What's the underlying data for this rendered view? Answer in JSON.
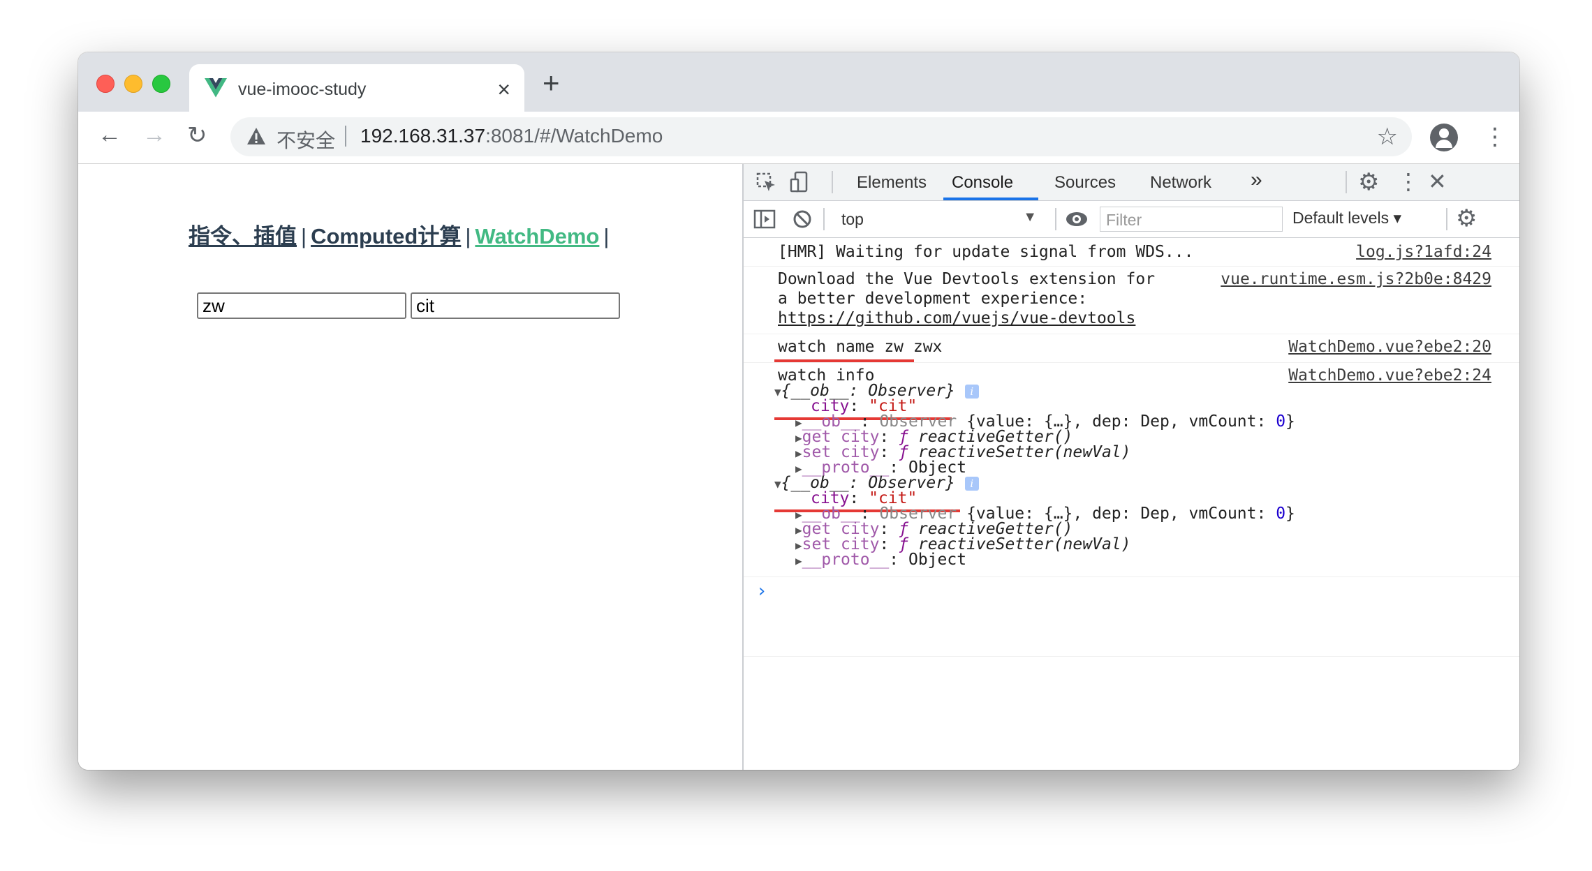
{
  "browser": {
    "tab_title": "vue-imooc-study",
    "tab_close": "×",
    "new_tab": "+",
    "security_label": "不安全",
    "url_host": "192.168.31.37",
    "url_rest": ":8081/#/WatchDemo"
  },
  "page": {
    "nav": [
      {
        "label": "指令、插值",
        "active": false
      },
      {
        "label": "Computed计算",
        "active": false
      },
      {
        "label": "WatchDemo",
        "active": true
      }
    ],
    "pipe": "|",
    "name_input_value": "zw",
    "city_input_value": "cit"
  },
  "devtools": {
    "tabs": [
      "Elements",
      "Console",
      "Sources",
      "Network"
    ],
    "active_tab": "Console",
    "more_tabs": "»",
    "context": "top",
    "filter_placeholder": "Filter",
    "levels": "Default levels ▾",
    "messages": {
      "hmr": {
        "text": "[HMR] Waiting for update signal from WDS...",
        "source": "log.js?1afd:24"
      },
      "devtools_ext": {
        "line1": "Download the Vue Devtools extension for",
        "line2": "a better development experience:",
        "line3": "https://github.com/vuejs/vue-devtools",
        "source": "vue.runtime.esm.js?2b0e:8429"
      },
      "watch_name": {
        "text": "watch name zw zwx",
        "source": "WatchDemo.vue?ebe2:20"
      },
      "watch_info": {
        "text": "watch info",
        "source": "WatchDemo.vue?ebe2:24"
      }
    },
    "object_preview": "{__ob__: Observer}",
    "city_key": "city",
    "city_value": "\"cit\"",
    "ob_key": "__ob__",
    "ob_value_prefix": "Observer",
    "ob_value_rest": " {value: {…}, dep: Dep, vmCount: ",
    "ob_vmcount": "0",
    "get_city": "get city",
    "set_city": "set city",
    "getter": "reactiveGetter()",
    "setter": "reactiveSetter(newVal)",
    "proto_key": "__proto__",
    "proto_value": "Object",
    "f": "ƒ",
    "prompt": "›"
  }
}
